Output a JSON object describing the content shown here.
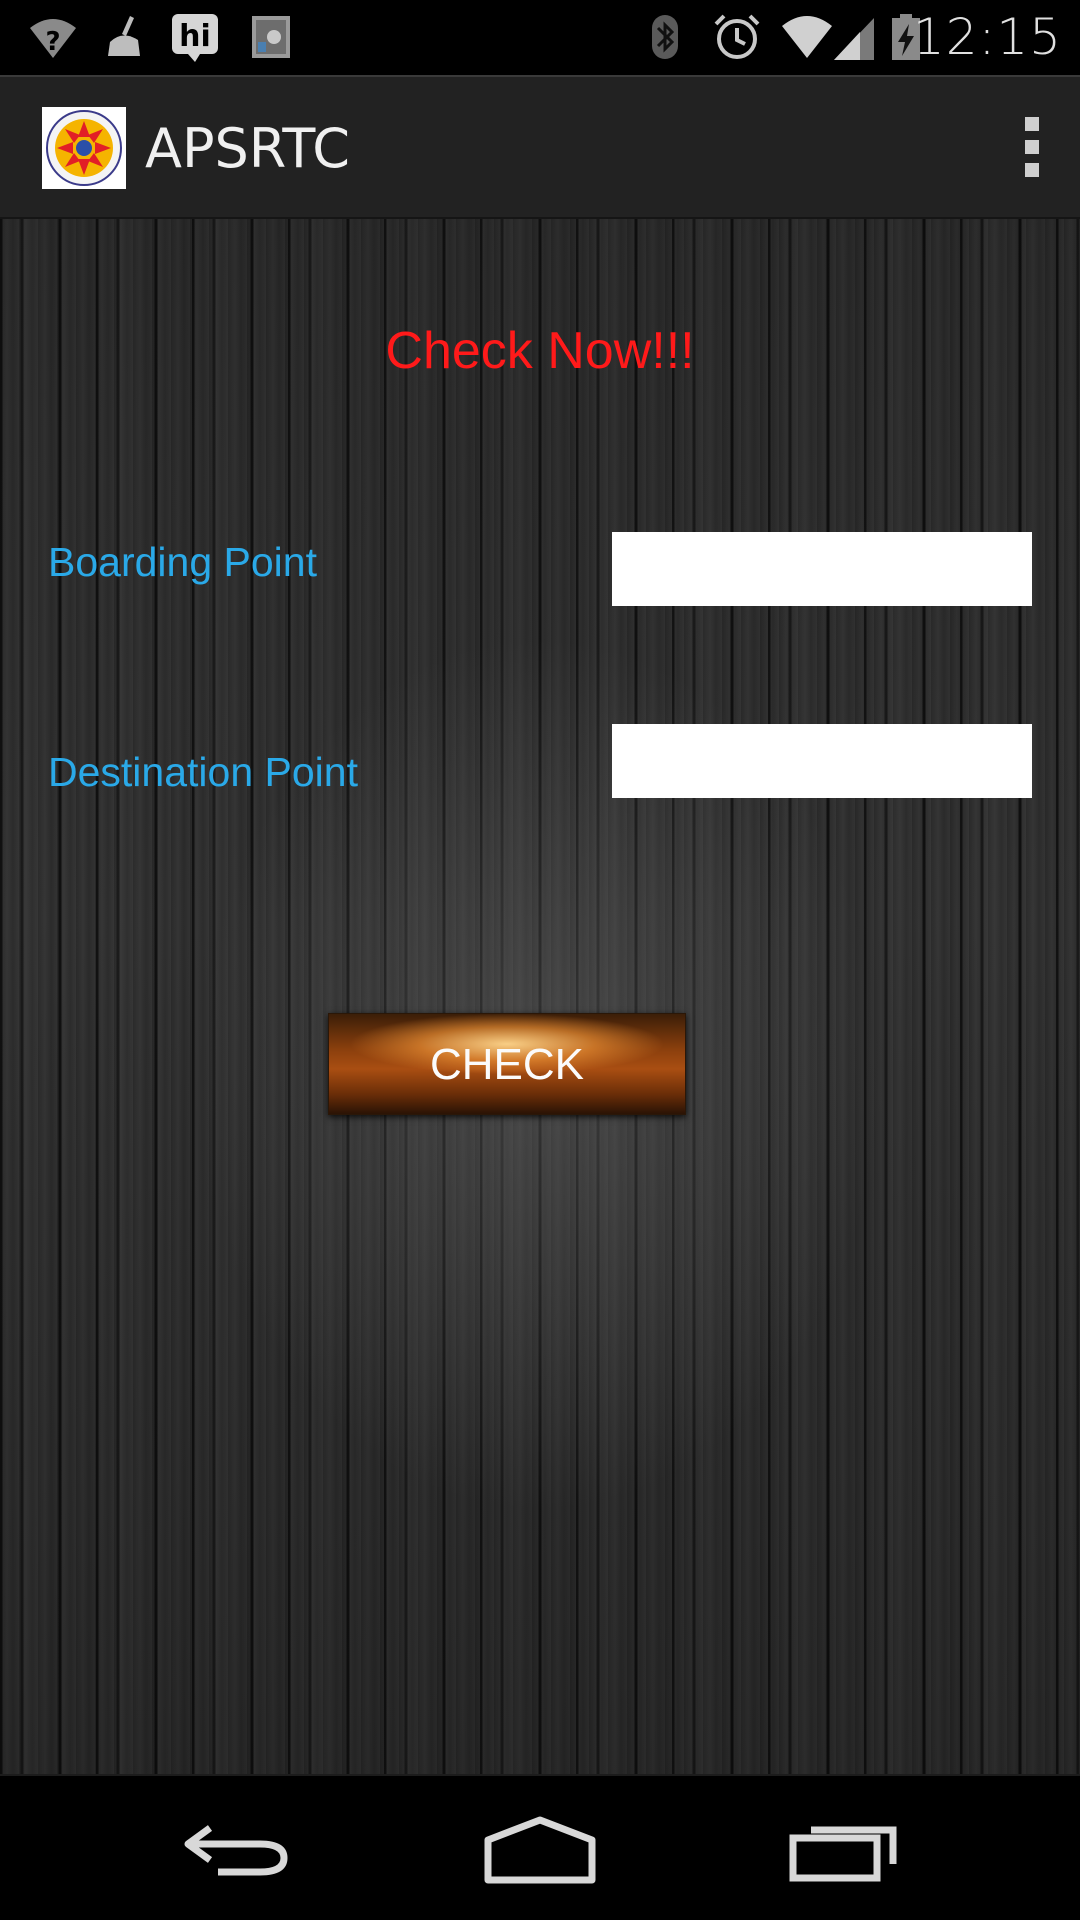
{
  "status_bar": {
    "time": "12:15",
    "icons": [
      "wifi-question-icon",
      "cleaner-icon",
      "hike-hi-icon",
      "app-safe-icon",
      "bluetooth-icon",
      "alarm-icon",
      "wifi-icon",
      "signal-icon",
      "battery-charging-icon"
    ]
  },
  "action_bar": {
    "title": "APSRTC",
    "logo": "apsrtc-logo",
    "overflow_icon": "overflow-menu-icon"
  },
  "main": {
    "heading": "Check Now!!!",
    "boarding_label": "Boarding Point",
    "boarding_value": "",
    "destination_label": "Destination Point",
    "destination_value": "",
    "check_button": "CHECK"
  },
  "nav_bar": {
    "icons": [
      "back-icon",
      "home-icon",
      "recents-icon"
    ]
  },
  "colors": {
    "heading": "#ff1a1a",
    "labels": "#2aa9e8",
    "button": "#a94e12"
  }
}
